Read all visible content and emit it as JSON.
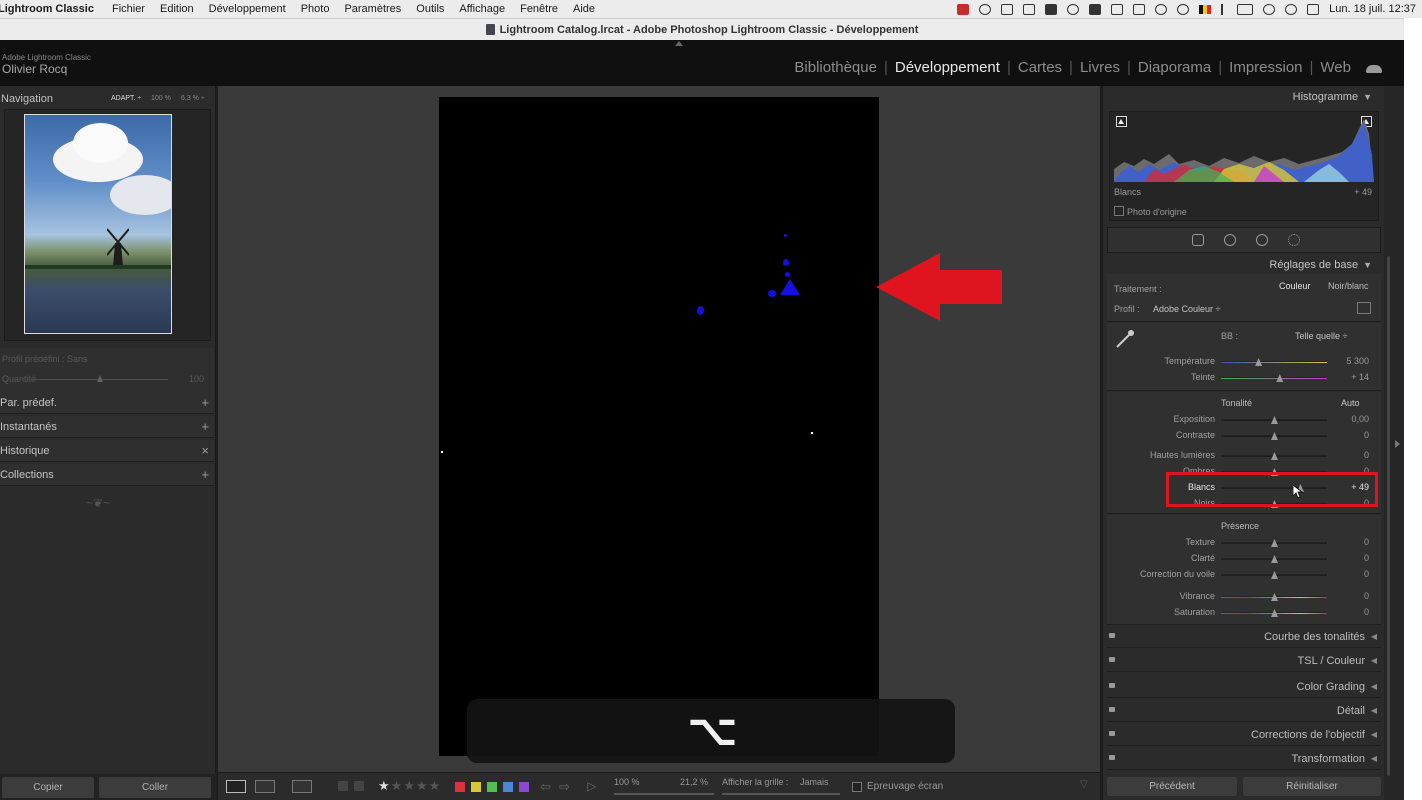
{
  "menubar": {
    "app": "Lightroom Classic",
    "items": [
      "Fichier",
      "Edition",
      "Développement",
      "Photo",
      "Paramètres",
      "Outils",
      "Affichage",
      "Fenêtre",
      "Aide"
    ],
    "clock": "Lun. 18 juil.  12:37"
  },
  "window": {
    "title": "Lightroom Catalog.lrcat - Adobe Photoshop Lightroom Classic - Développement"
  },
  "identity": {
    "small": "Adobe Lightroom Classic",
    "name": "Olivier Rocq"
  },
  "modules": [
    "Bibliothèque",
    "Développement",
    "Cartes",
    "Livres",
    "Diaporama",
    "Impression",
    "Web"
  ],
  "navigator": {
    "title": "Navigation",
    "zooms": [
      "ADAPT. ÷",
      "100 %",
      "6,3 % ÷"
    ]
  },
  "left_dim": {
    "line1": "Profil prédéfini : Sans",
    "line2": "Quantité",
    "value": "100"
  },
  "left_panels": [
    {
      "label": "Par. prédef.",
      "action": "+"
    },
    {
      "label": "Instantanés",
      "action": "+"
    },
    {
      "label": "Historique",
      "action": "×"
    },
    {
      "label": "Collections",
      "action": "+"
    }
  ],
  "left_buttons": {
    "copy": "Copier",
    "paste": "Coller"
  },
  "hud": {
    "symbol": "⌥"
  },
  "toolbar": {
    "zoom1": "100 %",
    "zoom2": "21,2 %",
    "grid_label": "Afficher la grille :",
    "grid_value": "Jamais",
    "proof": "Epreuvage écran",
    "rating": 1,
    "colors": [
      "#d9343c",
      "#d8c838",
      "#4fbf4f",
      "#4a86d6",
      "#8a4ad0"
    ]
  },
  "histogram": {
    "title": "Histogramme",
    "label": "Blancs",
    "value": "+ 49",
    "original": "Photo d'origine"
  },
  "basic": {
    "title": "Réglages de base",
    "treatment_label": "Traitement :",
    "treatment_options": [
      "Couleur",
      "Noir/blanc"
    ],
    "profile_label": "Profil :",
    "profile_value": "Adobe Couleur ÷",
    "wb_label": "BB :",
    "wb_value": "Telle quelle ÷",
    "tone_label": "Tonalité",
    "auto": "Auto",
    "presence_label": "Présence",
    "sliders_wb": [
      {
        "label": "Température",
        "value": "5 300",
        "level": 0.35
      },
      {
        "label": "Teinte",
        "value": "+ 14",
        "level": 0.55
      }
    ],
    "sliders_tone": [
      {
        "label": "Exposition",
        "value": "0,00",
        "level": 0.5
      },
      {
        "label": "Contraste",
        "value": "0",
        "level": 0.5
      },
      {
        "label": "Hautes lumières",
        "value": "0",
        "level": 0.5
      },
      {
        "label": "Ombres",
        "value": "0",
        "level": 0.5
      },
      {
        "label": "Blancs",
        "value": "+ 49",
        "level": 0.745
      },
      {
        "label": "Noirs",
        "value": "0",
        "level": 0.5
      }
    ],
    "sliders_presence": [
      {
        "label": "Texture",
        "value": "0",
        "level": 0.5
      },
      {
        "label": "Clarté",
        "value": "0",
        "level": 0.5
      },
      {
        "label": "Correction du voile",
        "value": "0",
        "level": 0.5
      },
      {
        "label": "Vibrance",
        "value": "0",
        "level": 0.5
      },
      {
        "label": "Saturation",
        "value": "0",
        "level": 0.5
      }
    ]
  },
  "collapsed_panels": [
    "Courbe des tonalités",
    "TSL / Couleur",
    "Color Grading",
    "Détail",
    "Corrections de l'objectif",
    "Transformation"
  ],
  "right_buttons": {
    "previous": "Précédent",
    "reset": "Réinitialiser"
  },
  "colors": {
    "highlight": "#e0141e",
    "arrow": "#e0141e",
    "clip_overlay": "#1410e0"
  }
}
